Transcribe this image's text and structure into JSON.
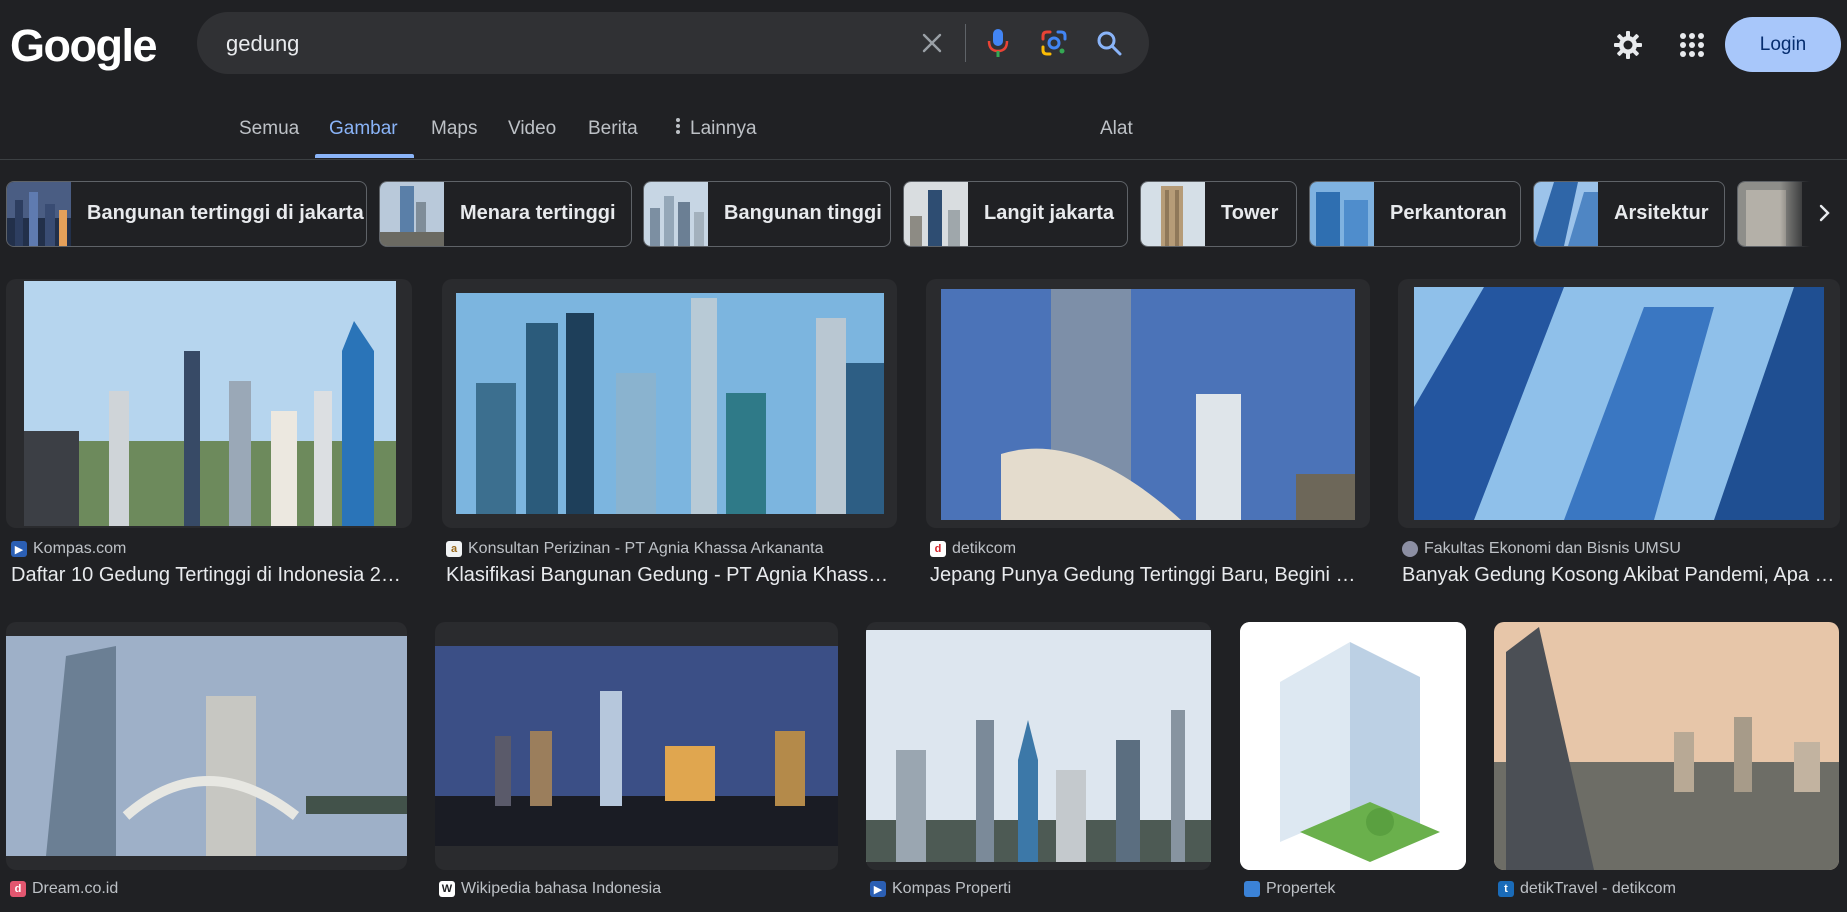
{
  "logo": "Google",
  "search": {
    "query": "gedung",
    "icons": [
      "clear-icon",
      "microphone-icon",
      "google-lens-icon",
      "search-icon"
    ]
  },
  "header": {
    "settings_icon": "gear-icon",
    "apps_icon": "apps-grid-icon",
    "login_label": "Login",
    "login_bg": "#a8c7fa"
  },
  "tabs": {
    "semua": "Semua",
    "gambar": "Gambar",
    "maps": "Maps",
    "video": "Video",
    "berita": "Berita",
    "lainnya": "Lainnya",
    "alat": "Alat",
    "active_color": "#8ab4f8"
  },
  "chips": [
    {
      "label": "Bangunan tertinggi di jakarta"
    },
    {
      "label": "Menara tertinggi"
    },
    {
      "label": "Bangunan tinggi"
    },
    {
      "label": "Langit jakarta"
    },
    {
      "label": "Tower"
    },
    {
      "label": "Perkantoran"
    },
    {
      "label": "Arsitektur"
    }
  ],
  "results": [
    {
      "source": "Kompas.com",
      "title": "Daftar 10 Gedung Tertinggi di Indonesia 2…"
    },
    {
      "source": "Konsultan Perizinan - PT Agnia Khassa Arkananta",
      "title": "Klasifikasi Bangunan Gedung - PT Agnia Khass…"
    },
    {
      "source": "detikcom",
      "title": "Jepang Punya Gedung Tertinggi Baru, Begini …"
    },
    {
      "source": "Fakultas Ekonomi dan Bisnis UMSU",
      "title": "Banyak Gedung Kosong Akibat Pandemi, Apa …"
    },
    {
      "source": "Dream.co.id",
      "title": ""
    },
    {
      "source": "Wikipedia bahasa Indonesia",
      "title": ""
    },
    {
      "source": "Kompas Properti",
      "title": ""
    },
    {
      "source": "Propertek",
      "title": ""
    },
    {
      "source": "detikTravel - detikcom",
      "title": ""
    }
  ]
}
